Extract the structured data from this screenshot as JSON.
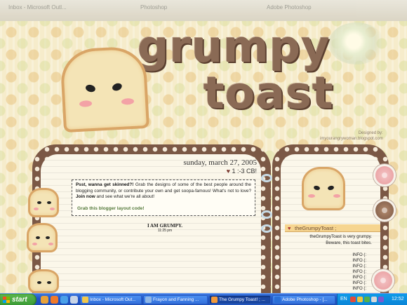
{
  "background_windows": {
    "tab_1": "Inbox - Microsoft Outl...",
    "tab_2": "Photoshop",
    "tab_3": "Adobe Photoshop"
  },
  "header": {
    "title_line_1": "grumpy",
    "title_line_2": "toast",
    "designed_by_label": "Designed by:",
    "designed_by_url": "imyourangrywoman.blogspot.com"
  },
  "post": {
    "date": "sunday, march 27, 2005",
    "cb_text": "1 :-3 CB!",
    "notice": {
      "lead": "Psst, wanna get skinned?!",
      "body": "Grab the designs of some of the best people around the blogging community, or contribute your own and get soopa-famous! What's not to love?",
      "join": "Join now",
      "tail": "and see what we're all about!"
    },
    "grab_link": "Grab this blogger layout code!",
    "heading": "I AM GRUMPY.",
    "time": "11:25 pm"
  },
  "sidebar": {
    "title": "theGrumpyToast ;",
    "description_1": "theGrumpyToast is very grumpy.",
    "description_2": "Beware, this toast bites.",
    "info_items": [
      "INFO (:",
      "INFO (:",
      "INFO (:",
      "INFO (:",
      "INFO (:",
      "INFO (:",
      "INFO (:"
    ]
  },
  "taskbar": {
    "start_label": "start",
    "tasks": [
      {
        "label": "Inbox - Microsoft Out...",
        "color": "#f2c84b",
        "active": false
      },
      {
        "label": "Frayon and Fanning ...",
        "color": "#8fb7e6",
        "active": false
      },
      {
        "label": "The Grumpy Toast! ; ...",
        "color": "#f29a3a",
        "active": true
      },
      {
        "label": "Adobe Photoshop - [...",
        "color": "#2a6fd6",
        "active": false
      }
    ],
    "language": "EN",
    "clock": "12:52"
  },
  "colors": {
    "title_brown": "#8a6a55",
    "frame_brown": "#7b5845",
    "toast_crust": "#d9a566",
    "link_green": "#557a3b",
    "taskbar_blue": "#2155c8"
  }
}
